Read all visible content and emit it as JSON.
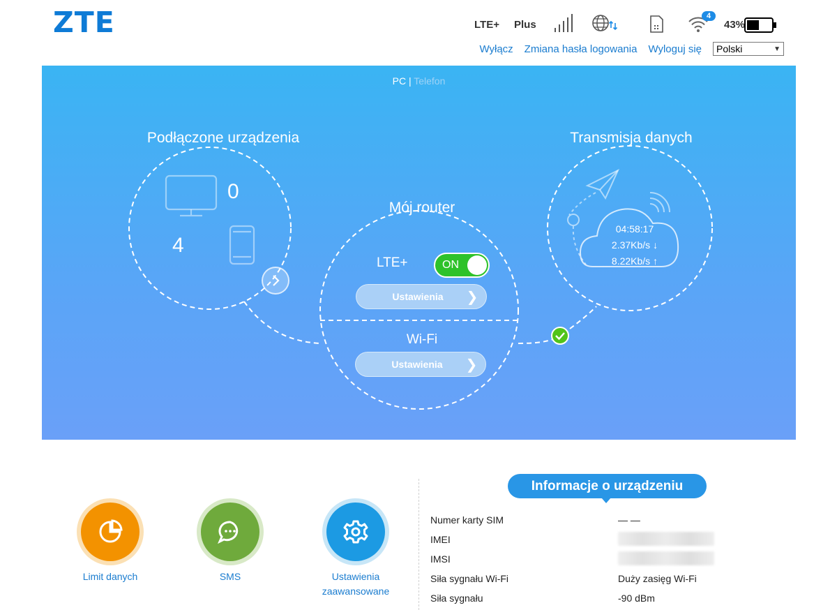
{
  "header": {
    "logo": "ZTE",
    "status": {
      "network_type": "LTE+",
      "network_suffix": "Plus",
      "signal_icon": "signal-bars-icon",
      "roaming_icon": "globe-data-icon",
      "sim_icon": "sim-card-icon",
      "wifi_icon": "wifi-icon",
      "wifi_clients": "4",
      "battery_percent": "43%"
    },
    "links": {
      "power_off": "Wyłącz",
      "change_password": "Zmiana hasła logowania",
      "logout": "Wyloguj się"
    },
    "language": {
      "selected": "Polski"
    }
  },
  "hero": {
    "view_switch": {
      "pc": "PC",
      "separator": "|",
      "phone": "Telefon"
    },
    "connected_devices": {
      "title": "Podłączone urządzenia",
      "pc_count": "0",
      "phone_count": "4"
    },
    "router": {
      "title": "Mój router",
      "lte_label": "LTE+",
      "lte_toggle": "ON",
      "lte_settings": "Ustawienia",
      "wifi_label": "Wi-Fi",
      "wifi_settings": "Ustawienia"
    },
    "data_transfer": {
      "title": "Transmisja danych",
      "duration": "04:58:17",
      "download": "2.37Kb/s ↓",
      "upload": "8.22Kb/s ↑"
    }
  },
  "shortcuts": [
    {
      "label": "Limit danych",
      "icon": "pie-chart-icon",
      "color": "#f39200"
    },
    {
      "label": "SMS",
      "icon": "chat-bubble-icon",
      "color": "#6faa3c"
    },
    {
      "label": "Ustawienia zaawansowane",
      "icon": "gear-icon",
      "color": "#1c9ae3"
    }
  ],
  "device_info": {
    "title": "Informacje o urządzeniu",
    "rows": [
      {
        "key": "Numer karty SIM",
        "value": "— —"
      },
      {
        "key": "IMEI",
        "value": ""
      },
      {
        "key": "IMSI",
        "value": ""
      },
      {
        "key": "Siła sygnału Wi-Fi",
        "value": "Duży zasięg Wi-Fi"
      },
      {
        "key": "Siła sygnału",
        "value": "-90 dBm"
      }
    ]
  },
  "colors": {
    "brand": "#0e7bd6",
    "link": "#1a7ccf",
    "toggle_on": "#2ec22a",
    "info_badge": "#2996e6"
  }
}
